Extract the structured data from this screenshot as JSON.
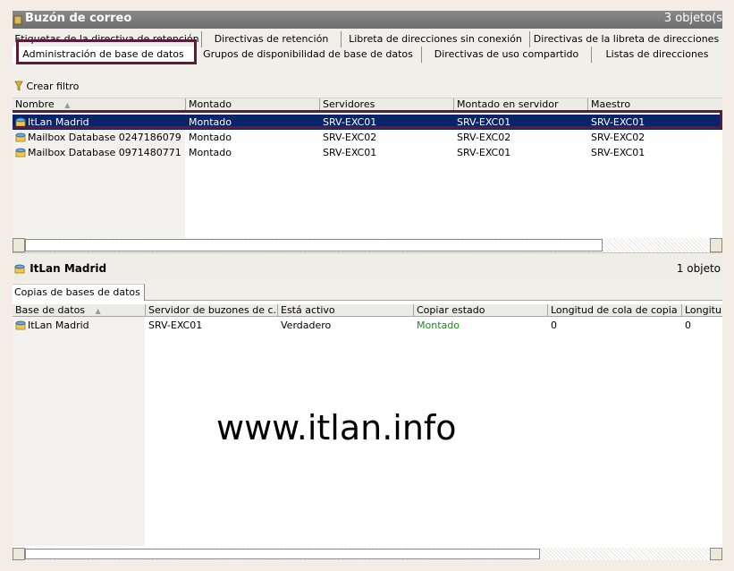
{
  "window": {
    "title": "Buzón de correo",
    "count": "3 objeto(s"
  },
  "tabs": {
    "row1": [
      {
        "label": "Etiquetas de la directiva de retención"
      },
      {
        "label": "Directivas de retención"
      },
      {
        "label": "Libreta de direcciones sin conexión"
      },
      {
        "label": "Directivas de la libreta de direcciones"
      }
    ],
    "row2": [
      {
        "label": "Administración de base de datos",
        "active": true
      },
      {
        "label": "Grupos de disponibilidad de base de datos"
      },
      {
        "label": "Directivas de uso compartido"
      },
      {
        "label": "Listas de direcciones"
      }
    ]
  },
  "toolbar": {
    "filter_label": "Crear filtro"
  },
  "databases": {
    "columns": [
      "Nombre",
      "Montado",
      "Servidores",
      "Montado en servidor",
      "Maestro"
    ],
    "rows": [
      {
        "name": "ItLan Madrid",
        "mounted": "Montado",
        "servers": "SRV-EXC01",
        "mounted_on": "SRV-EXC01",
        "master": "SRV-EXC01",
        "selected": true
      },
      {
        "name": "Mailbox Database 0247186079",
        "mounted": "Montado",
        "servers": "SRV-EXC02",
        "mounted_on": "SRV-EXC02",
        "master": "SRV-EXC02"
      },
      {
        "name": "Mailbox Database 0971480771",
        "mounted": "Montado",
        "servers": "SRV-EXC01",
        "mounted_on": "SRV-EXC01",
        "master": "SRV-EXC01"
      }
    ]
  },
  "detail": {
    "title": "ItLan Madrid",
    "count": "1 objeto"
  },
  "subtabs": [
    {
      "label": "Copias de bases de datos"
    }
  ],
  "copies": {
    "columns": [
      "Base de datos",
      "Servidor de buzones de c...",
      "Está activo",
      "Copiar estado",
      "Longitud de cola de copia",
      "Longitu"
    ],
    "rows": [
      {
        "database": "ItLan Madrid",
        "server": "SRV-EXC01",
        "active": "Verdadero",
        "status": "Montado",
        "copy_queue": "0",
        "replay_queue": "0"
      }
    ]
  },
  "watermark": "www.itlan.info",
  "colors": {
    "selection": "#0a246a",
    "highlight_box": "#5e1a3a",
    "status_green": "#1a8a1a"
  }
}
